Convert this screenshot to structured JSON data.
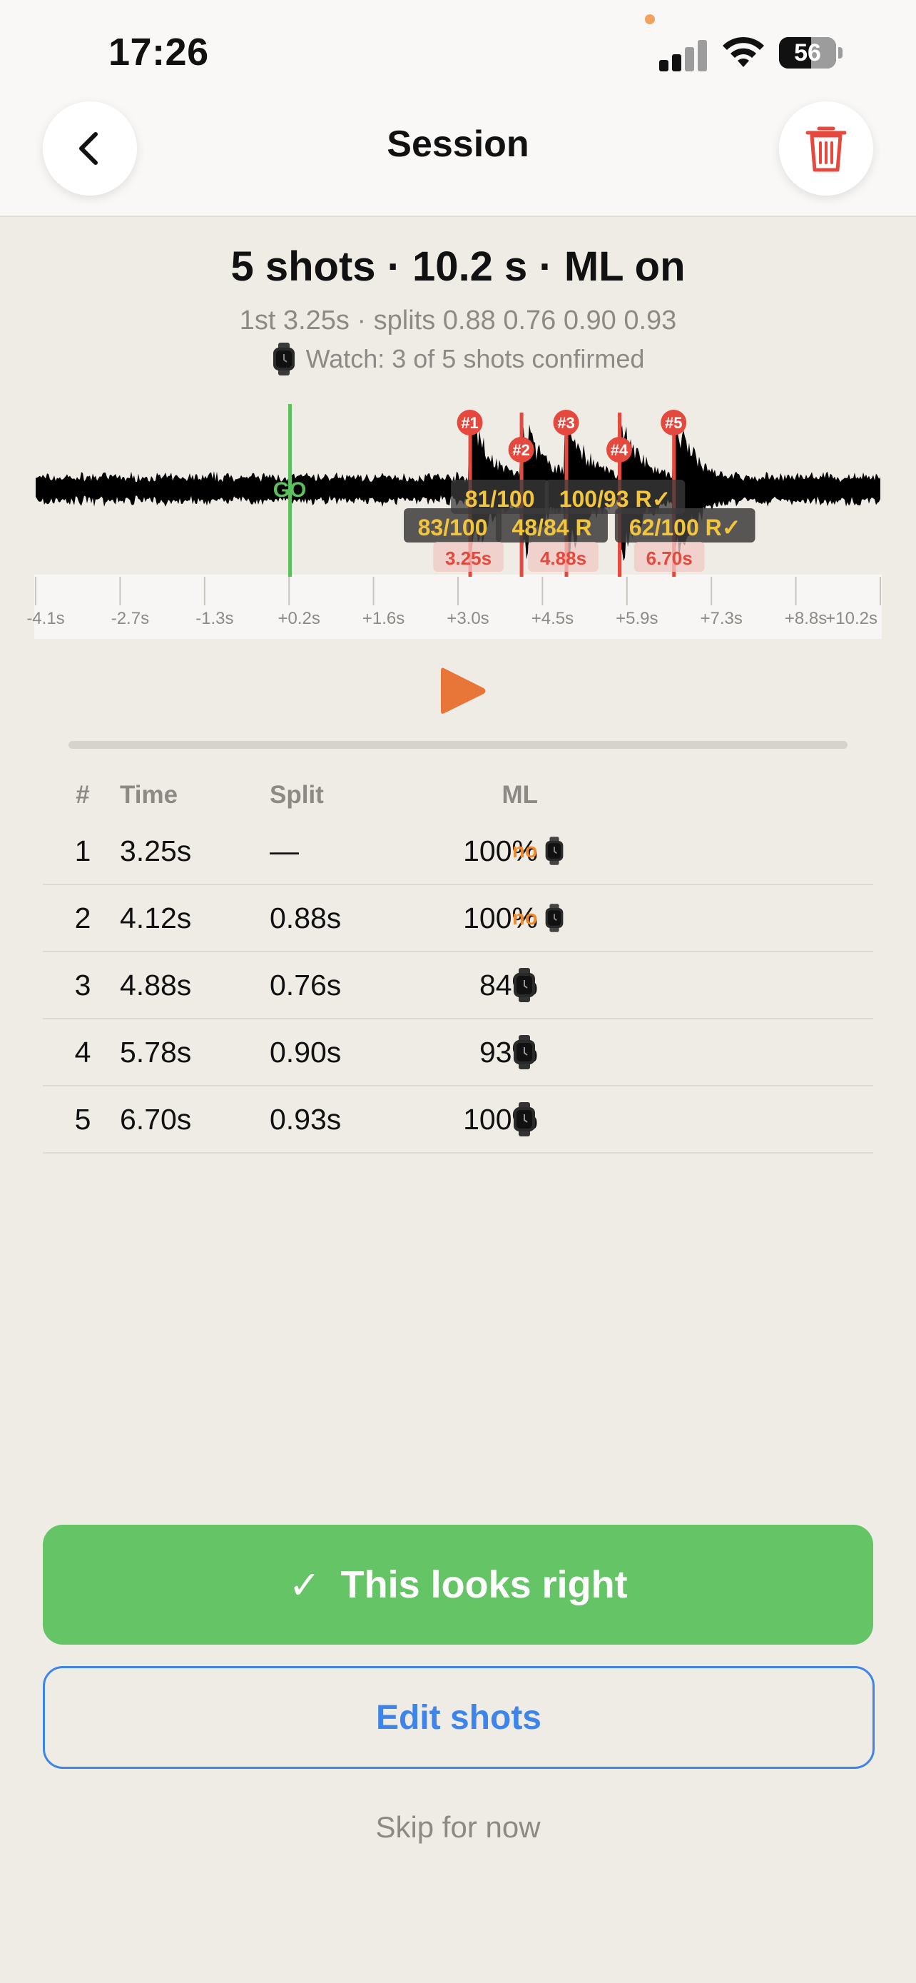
{
  "status_bar": {
    "time": "17:26",
    "battery": "56",
    "battery_level": 0.56
  },
  "nav": {
    "title": "Session",
    "back_icon": "chevron-left-icon",
    "delete_icon": "trash-icon",
    "delete_color": "#e5483d"
  },
  "summary": {
    "title": "5 shots  ·  10.2 s · ML on",
    "subtitle": "1st 3.25s · splits 0.88 0.76 0.90 0.93",
    "watch_text": "Watch: 3 of 5 shots confirmed"
  },
  "waveform": {
    "go_label": "GO",
    "go_time": 0.2,
    "markers": [
      {
        "label": "#1",
        "time": 3.25
      },
      {
        "label": "#2",
        "time": 4.12
      },
      {
        "label": "#3",
        "time": 4.88
      },
      {
        "label": "#4",
        "time": 5.78
      },
      {
        "label": "#5",
        "time": 6.7
      }
    ],
    "badges_row1": [
      "81/100",
      "100/93 R✓"
    ],
    "badges_row2": [
      "83/100",
      "48/84 R",
      "62/100 R✓"
    ],
    "time_tags": [
      "3.25s",
      "4.88s",
      "6.70s"
    ],
    "ticks": [
      "-4.1s",
      "-2.7s",
      "-1.3s",
      "+0.2s",
      "+1.6s",
      "+3.0s",
      "+4.5s",
      "+5.9s",
      "+7.3s",
      "+8.8s",
      "+10.2s"
    ],
    "colors": {
      "go": "#5cc05c",
      "marker": "#e5483d",
      "badge_text": "#f3c53a",
      "wave": "#000000"
    }
  },
  "player": {
    "play_icon": "play-icon",
    "play_color": "#e87638",
    "progress": 0.0
  },
  "table": {
    "headers": {
      "num": "#",
      "time": "Time",
      "split": "Split",
      "ml": "ML"
    },
    "rows": [
      {
        "num": "1",
        "time": "3.25s",
        "split": "—",
        "ml": "100%",
        "no": "no",
        "watch": true
      },
      {
        "num": "2",
        "time": "4.12s",
        "split": "0.88s",
        "ml": "100%",
        "no": "no",
        "watch": true
      },
      {
        "num": "3",
        "time": "4.88s",
        "split": "0.76s",
        "ml": "84%",
        "no": "",
        "watch": true
      },
      {
        "num": "4",
        "time": "5.78s",
        "split": "0.90s",
        "ml": "93%",
        "no": "",
        "watch": true
      },
      {
        "num": "5",
        "time": "6.70s",
        "split": "0.93s",
        "ml": "100%",
        "no": "",
        "watch": true
      }
    ]
  },
  "actions": {
    "confirm_check": "✓",
    "confirm_label": "This looks right",
    "confirm_color": "#65c466",
    "edit_label": "Edit shots",
    "skip_label": "Skip for now"
  }
}
